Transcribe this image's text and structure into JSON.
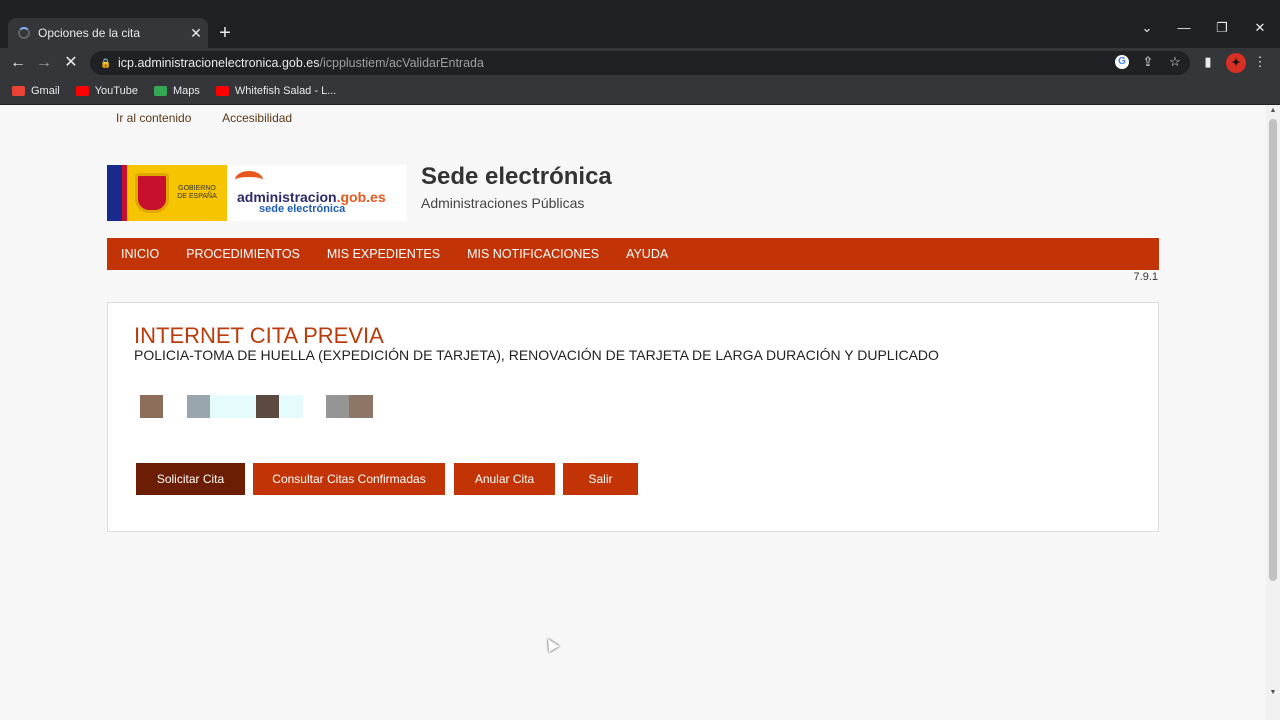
{
  "browser": {
    "tab_title": "Opciones de la cita",
    "new_tab": "+",
    "url_host": "icp.administracionelectronica.gob.es",
    "url_path": "/icpplustiem/acValidarEntrada",
    "bookmarks": [
      {
        "label": "Gmail",
        "icon": "gmail-icon",
        "color": "#ea4335"
      },
      {
        "label": "YouTube",
        "icon": "youtube-icon",
        "color": "#ff0000"
      },
      {
        "label": "Maps",
        "icon": "maps-icon",
        "color": "#34a853"
      },
      {
        "label": "Whitefish Salad - L...",
        "icon": "youtube-icon",
        "color": "#ff0000"
      }
    ]
  },
  "page": {
    "skip_links": [
      "Ir al contenido",
      "Accesibilidad"
    ],
    "logo": {
      "gob_text": "GOBIERNO DE ESPAÑA",
      "admin_name": "administracion",
      "admin_domain": ".gob.es",
      "admin_sub": "sede electrónica"
    },
    "site_title": "Sede electrónica",
    "site_subtitle": "Administraciones Públicas",
    "nav": [
      "INICIO",
      "PROCEDIMIENTOS",
      "MIS EXPEDIENTES",
      "MIS NOTIFICACIONES",
      "AYUDA"
    ],
    "version": "7.9.1",
    "panel": {
      "title": "INTERNET CITA PREVIA",
      "subtitle": "POLICIA-TOMA DE HUELLA (EXPEDICIÓN DE TARJETA), RENOVACIÓN DE TARJETA DE LARGA DURACIÓN Y DUPLICADO",
      "buttons": [
        "Solicitar Cita",
        "Consultar Citas Confirmadas",
        "Anular Cita",
        "Salir"
      ]
    }
  },
  "colors": {
    "nav_bg": "#c23405",
    "title": "#bb3c0a",
    "primary_button": "#6b1e04",
    "secondary_button": "#c23405"
  }
}
